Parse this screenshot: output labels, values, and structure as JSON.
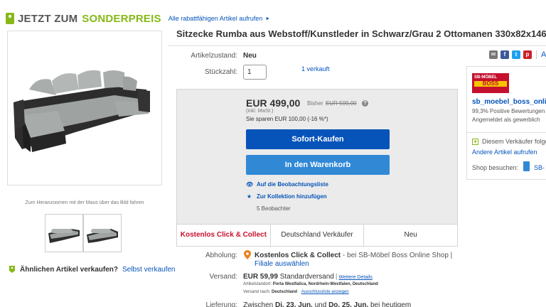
{
  "banner": {
    "part1": "JETZT ZUM",
    "part2": "SONDERPREIS",
    "link": "Alle rabattfähigen Artikel aufrufen",
    "arrow": "►"
  },
  "gallery": {
    "zoom_hint": "Zum Heranzoomen mit der Maus über das Bild fahren"
  },
  "sell_similar": {
    "question": "Ähnlichen Artikel verkaufen?",
    "link": "Selbst verkaufen"
  },
  "listing": {
    "title": "Sitzecke Rumba aus Webstoff/Kunstleder in Schwarz/Grau 2 Ottomanen 330x82x146",
    "condition_label": "Artikelzustand:",
    "condition_value": "Neu",
    "quantity_label": "Stückzahl:",
    "quantity_value": "1",
    "sold": "1 verkauft"
  },
  "buybox": {
    "price": "EUR 499,00",
    "was_label": "Bisher",
    "was_price": "EUR 599,00",
    "vat": "(inkl. MwSt.)",
    "savings": "Sie sparen EUR 100,00 (-16 %*)",
    "buy_now": "Sofort-Kaufen",
    "add_to_cart": "In den Warenkorb",
    "watchlist": "Auf die Beobachtungsliste",
    "collection": "Zur Kollektion hinzufügen",
    "watchers": "5 Beobachter"
  },
  "tabs": [
    {
      "label": "Kostenlos Click & Collect"
    },
    {
      "label": "Deutschland Verkäufer"
    },
    {
      "label": "Neu"
    }
  ],
  "pickup": {
    "label": "Abholung:",
    "title": "Kostenlos Click & Collect",
    "detail": " - bei SB-Möbel Boss Online Shop |",
    "link": "Filiale auswählen"
  },
  "shipping": {
    "label": "Versand:",
    "cost": "EUR 59,99",
    "method": "Standardversand",
    "details_link": "Weitere Details",
    "location_label": "Artikelstandort:",
    "location_value": "Porta Westfalica, Nordrhein-Westfalen, Deutschland",
    "ships_to_label": "Versand nach:",
    "ships_to_value": "Deutschland",
    "exclusions_link": "Ausschlussliste anzeigen"
  },
  "delivery": {
    "label": "Lieferung:",
    "prefix": "Zwischen",
    "date_from": "Di. 23. Jun.",
    "connector": "und",
    "date_to": "Do. 25. Jun.",
    "suffix": "bei heutigem"
  },
  "share": {
    "icons": [
      "mail-icon",
      "facebook-icon",
      "twitter-icon",
      "pinterest-icon"
    ],
    "watch_glyph": "A"
  },
  "seller": {
    "logo_top": "SB-MÖBEL",
    "logo_brand": "BOSS",
    "name": "sb_moebel_boss_online",
    "rating": "99,3% Positive Bewertungen",
    "since": "Angemeldet als gewerblich",
    "follow": "Diesem Verkäufer folgen",
    "other_items": "Andere Artikel aufrufen",
    "shop_label": "Shop besuchen:",
    "shop_link": "SB-"
  },
  "colors": {
    "ebay_blue": "#0654ba",
    "button_light_blue": "#3189d6",
    "sale_green": "#86b817",
    "active_tab_red": "#c8102e",
    "pin_orange": "#e8821e"
  }
}
